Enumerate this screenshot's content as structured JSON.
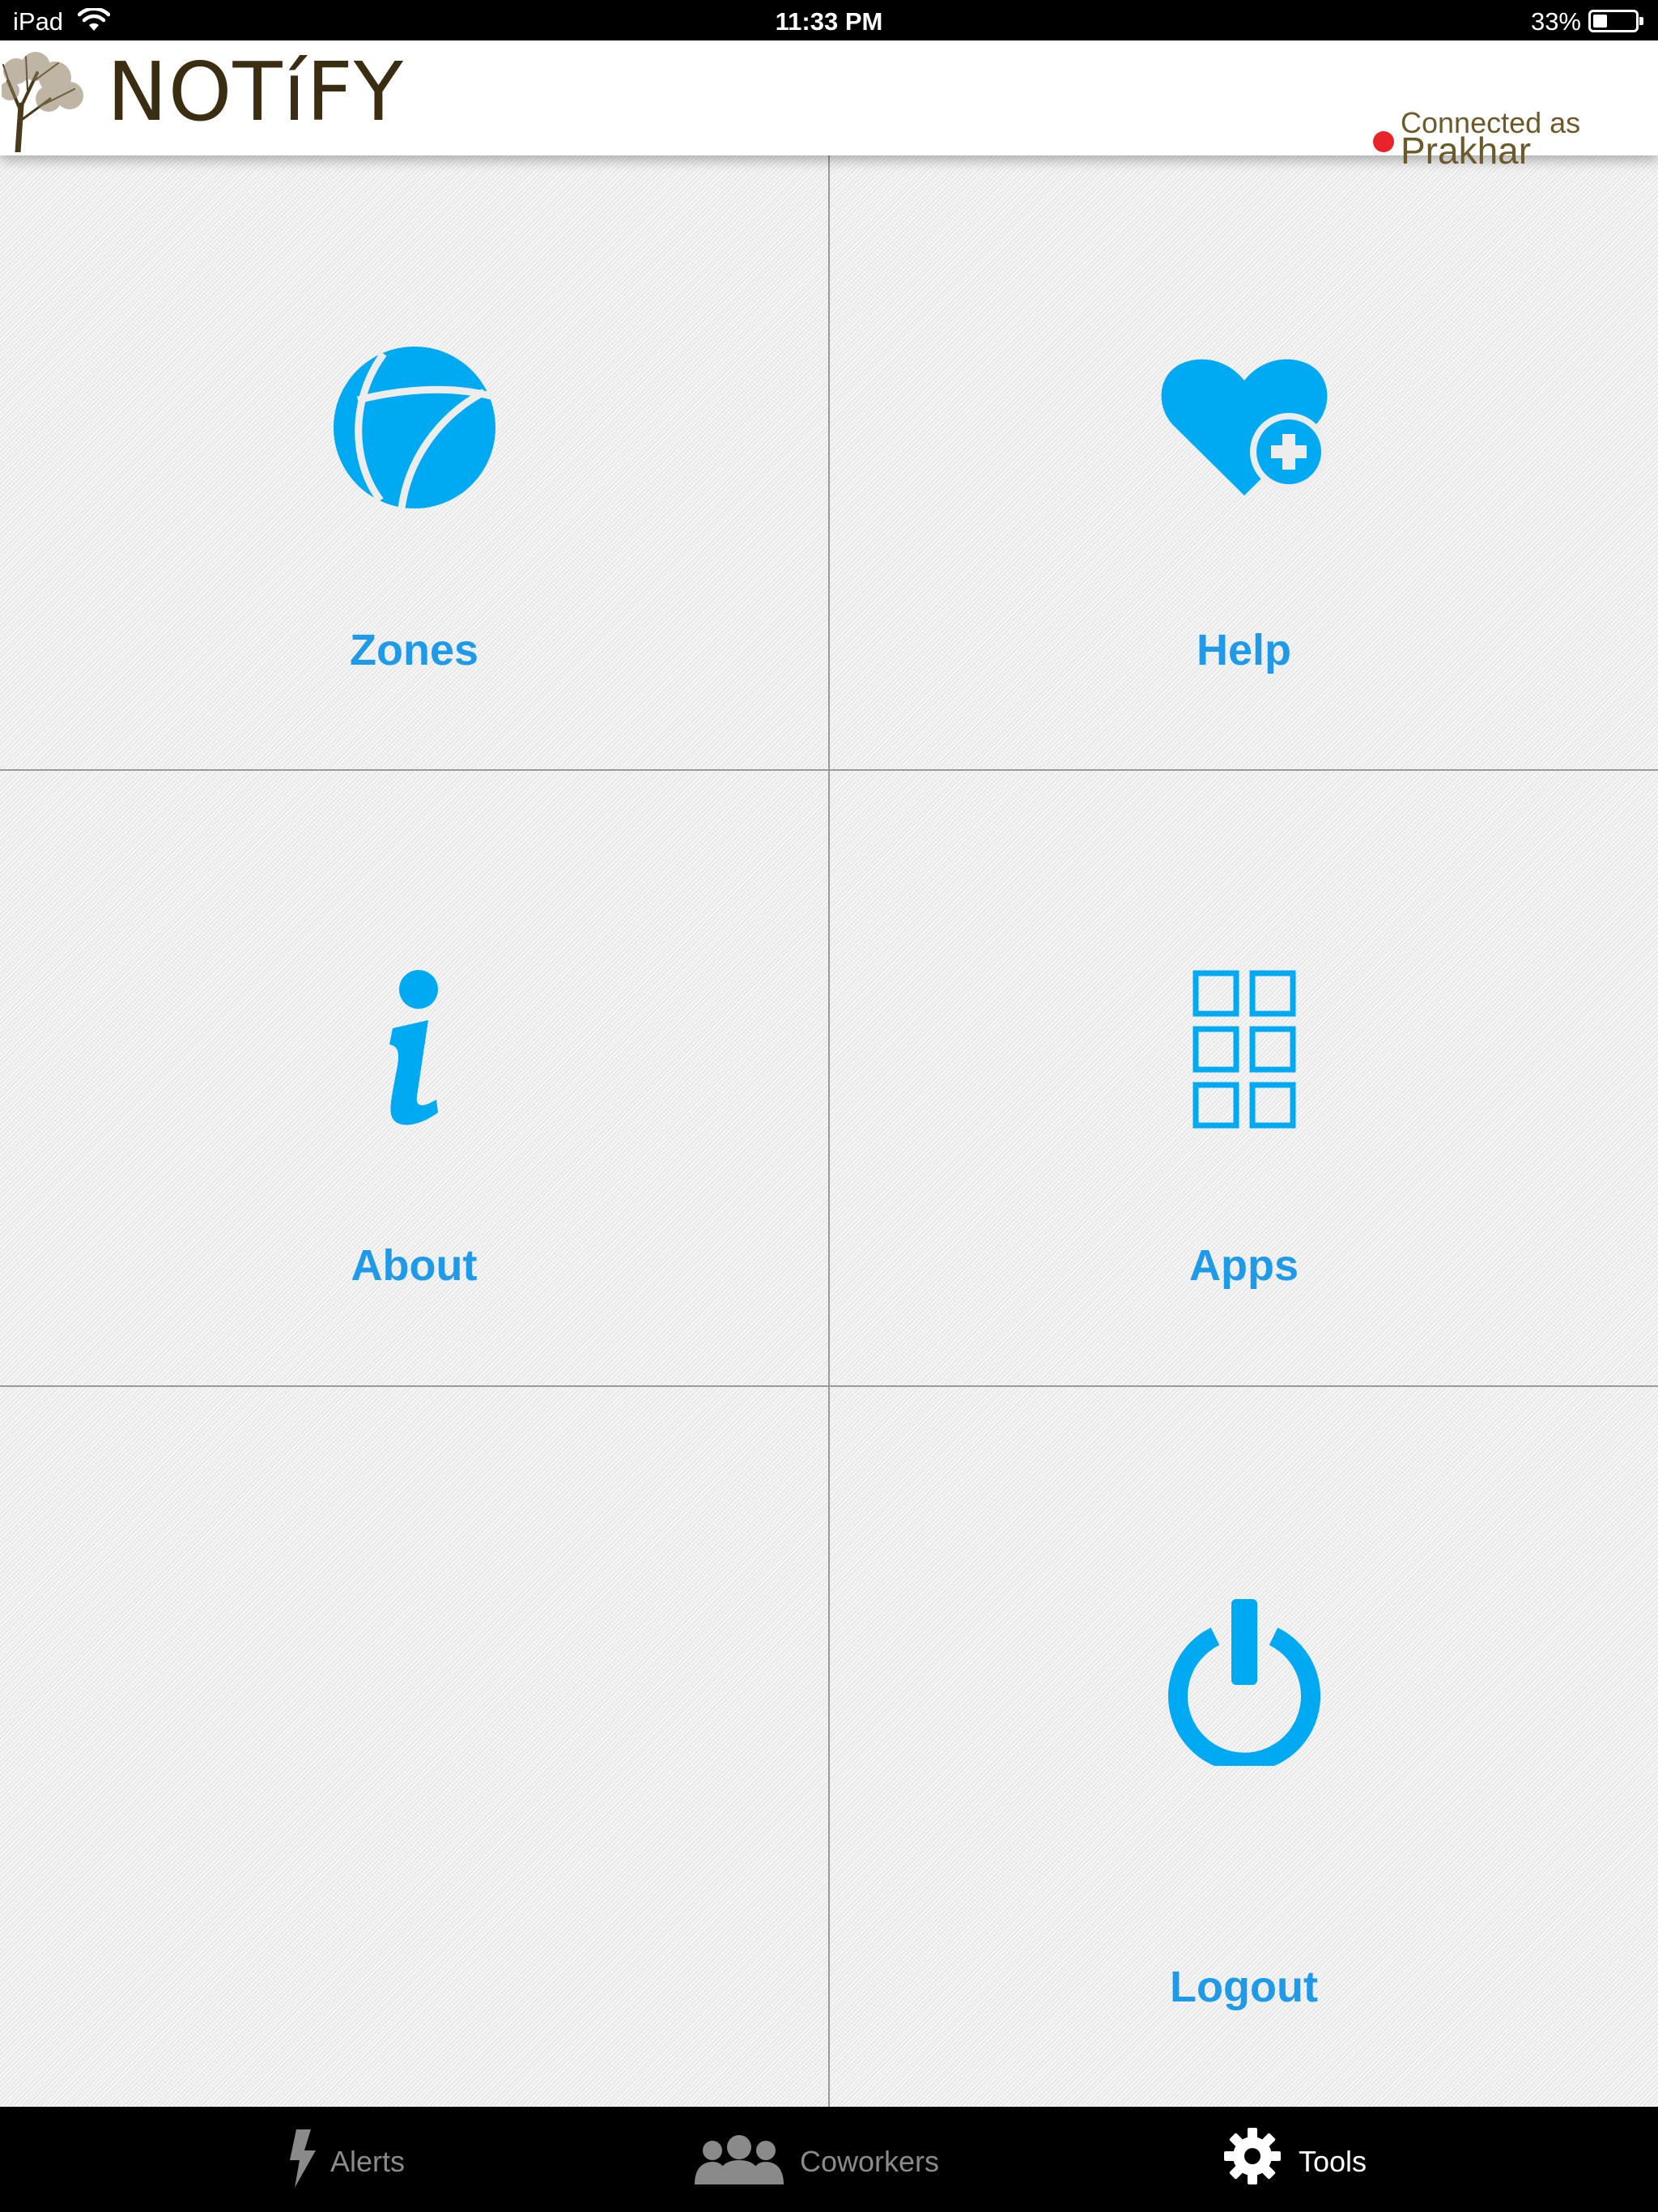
{
  "status_bar": {
    "device": "iPad",
    "time": "11:33 PM",
    "battery_percent": "33%",
    "battery_level": 0.33
  },
  "header": {
    "logo_text": "NOTíFY",
    "connected_label": "Connected as",
    "user_name": "Prakhar",
    "status_color": "#e8232b"
  },
  "tiles": [
    {
      "label": "Zones",
      "icon": "zones-icon"
    },
    {
      "label": "Help",
      "icon": "heart-plus-icon"
    },
    {
      "label": "About",
      "icon": "info-icon"
    },
    {
      "label": "Apps",
      "icon": "apps-grid-icon"
    },
    {
      "label": "Logout",
      "icon": "power-icon"
    }
  ],
  "tabbar": {
    "tabs": [
      {
        "label": "Alerts",
        "icon": "lightning-icon",
        "active": false
      },
      {
        "label": "Coworkers",
        "icon": "people-icon",
        "active": false
      },
      {
        "label": "Tools",
        "icon": "gear-icon",
        "active": true
      }
    ]
  },
  "colors": {
    "accent": "#1e9ae8",
    "icon_blue": "#00aaf2",
    "logo_brown": "#3a2d12"
  }
}
